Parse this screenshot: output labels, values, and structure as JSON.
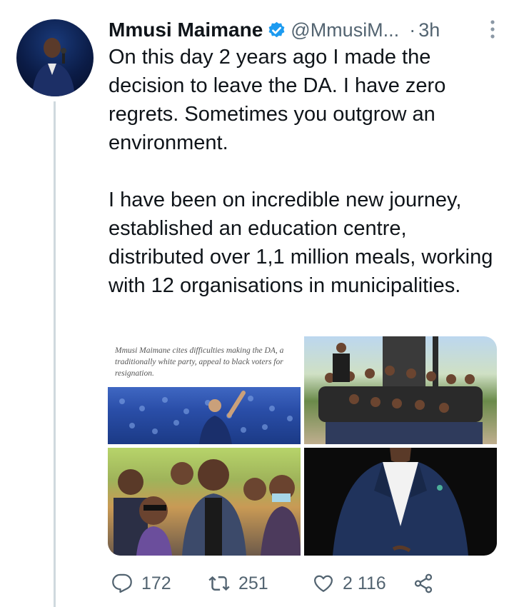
{
  "author": {
    "display_name": "Mmusi Maimane",
    "handle": "@MmusiM...",
    "time_separator": "·",
    "time": "3h",
    "verified_color": "#1d9bf0"
  },
  "tweet": {
    "text": "On this day 2 years ago I made the decision to leave the DA. I have zero regrets. Sometimes you outgrow an environment.\n\nI have been on incredible new journey, established an education centre, distributed over 1,1 million meals, working with 12 organisations in municipalities."
  },
  "media": {
    "tile1_caption": "Mmusi Maimane cites difficulties making the DA, a traditionally white party, appeal to black voters for resignation."
  },
  "actions": {
    "reply_count": "172",
    "retweet_count": "251",
    "like_count": "2 116"
  },
  "icons": {
    "reply": "reply-icon",
    "retweet": "retweet-icon",
    "like": "like-icon",
    "share": "share-icon",
    "more": "more-icon",
    "verified": "verified-badge-icon"
  },
  "colors": {
    "text": "#0f1419",
    "secondary": "#536471",
    "thread_line": "#cfd9de"
  }
}
